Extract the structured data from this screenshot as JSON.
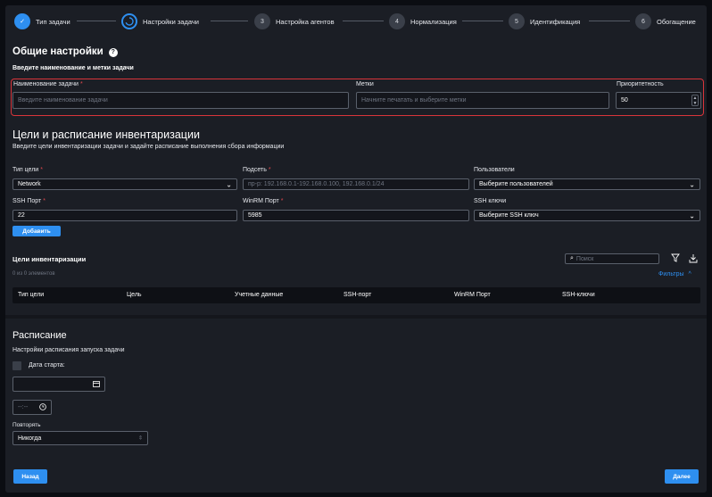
{
  "stepper": {
    "steps": [
      {
        "num": "✓",
        "label": "Тип задачи"
      },
      {
        "num": "",
        "label": "Настройки задачи"
      },
      {
        "num": "3",
        "label": "Настройка агентов"
      },
      {
        "num": "4",
        "label": "Нормализация"
      },
      {
        "num": "5",
        "label": "Идентификация"
      },
      {
        "num": "6",
        "label": "Обогащение"
      }
    ]
  },
  "general": {
    "title": "Общие настройки",
    "help": "?",
    "subtitle": "Введите наименование и метки задачи",
    "name_label": "Наименование задачи",
    "name_placeholder": "Введите наименование задачи",
    "tags_label": "Метки",
    "tags_placeholder": "Начните печатать и выберите метки",
    "priority_label": "Приоритетность",
    "priority_value": "50"
  },
  "targets": {
    "title": "Цели и расписание инвентаризации",
    "subtitle": "Введите цели инвентаризации задачи и задайте расписание выполнения сбора информации",
    "type_label": "Тип цели",
    "type_value": "Network",
    "subnet_label": "Подсеть",
    "subnet_placeholder": "пр-р: 192.168.0.1-192.168.0.100, 192.168.0.1/24",
    "users_label": "Пользователи",
    "users_value": "Выберите пользователей",
    "ssh_port_label": "SSH Порт",
    "ssh_port_value": "22",
    "winrm_port_label": "WinRM Порт",
    "winrm_port_value": "5985",
    "ssh_keys_label": "SSH ключи",
    "ssh_keys_value": "Выберите SSH ключ",
    "add_button": "Добавить"
  },
  "inventory_table": {
    "title": "Цели инвентаризации",
    "count": "0 из 0 элементов",
    "search_placeholder": "Поиск",
    "filters": "Фильтры",
    "columns": [
      "Тип цели",
      "Цель",
      "Учетные данные",
      "SSH-порт",
      "WinRM Порт",
      "SSH-ключи"
    ]
  },
  "schedule": {
    "title": "Расписание",
    "subtitle": "Настройки расписания запуска задачи",
    "start_date_label": "Дата старта:",
    "time_placeholder": "--:--",
    "repeat_label": "Повторять",
    "repeat_value": "Никогда"
  },
  "footer": {
    "back": "Назад",
    "next": "Далее"
  }
}
